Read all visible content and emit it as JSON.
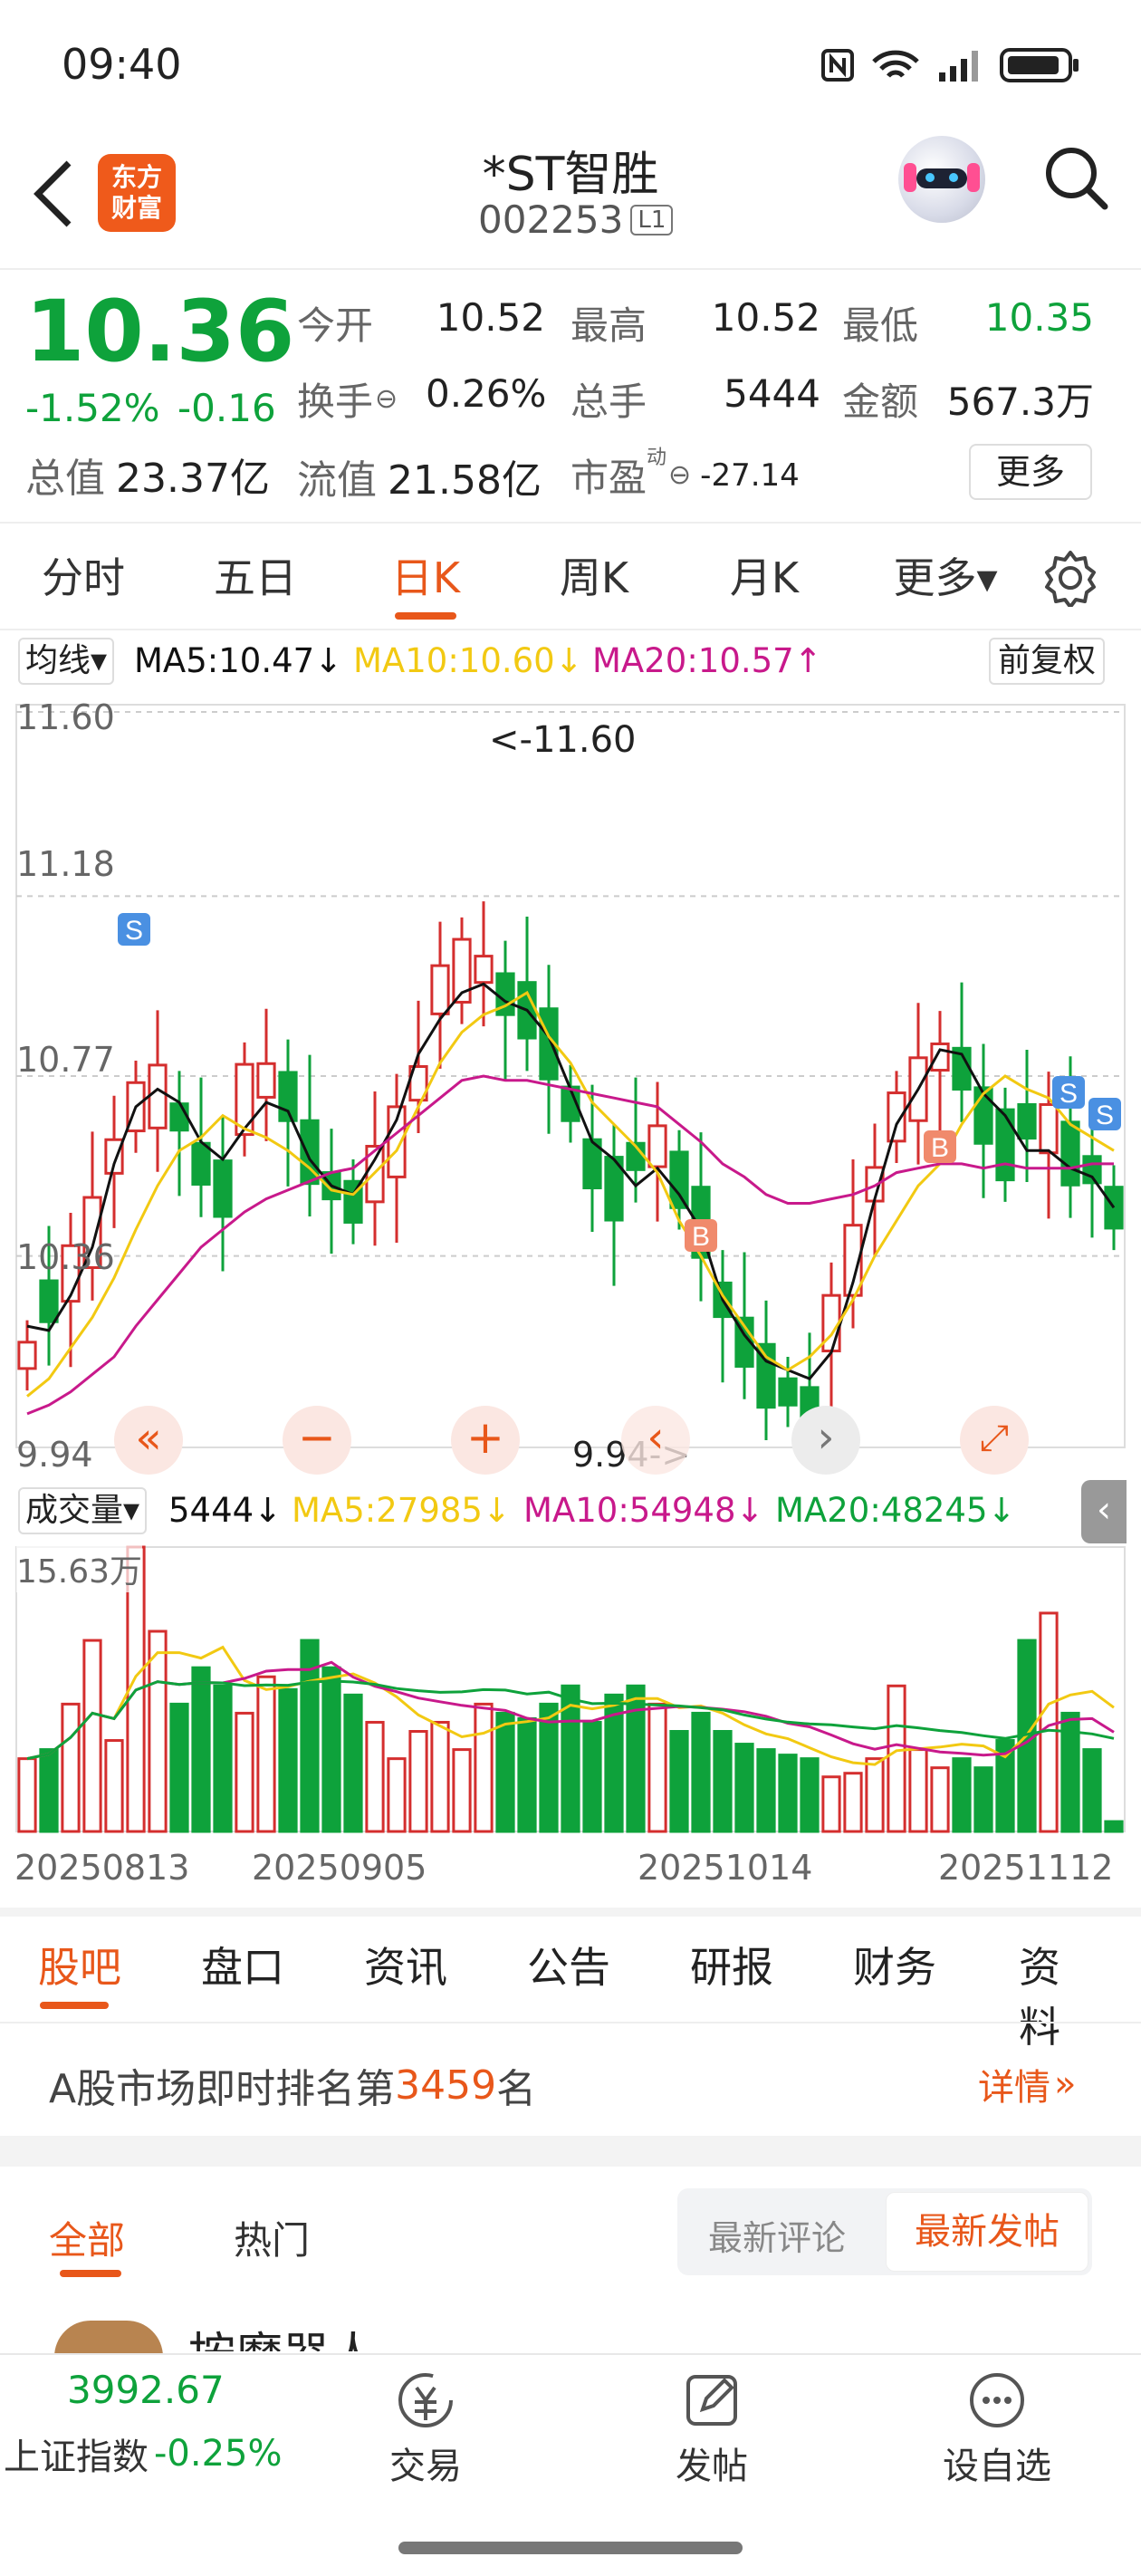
{
  "status": {
    "time": "09:40"
  },
  "header": {
    "logo_line1": "东方",
    "logo_line2": "财富",
    "stock_name": "*ST智胜",
    "stock_code": "002253",
    "level_badge": "L1"
  },
  "quote": {
    "price": "10.36",
    "change_pct": "-1.52%",
    "change": "-0.16",
    "open_label": "今开",
    "open": "10.52",
    "high_label": "最高",
    "high": "10.52",
    "low_label": "最低",
    "low": "10.35",
    "turnover_label": "换手",
    "turnover": "0.26%",
    "volume_label": "总手",
    "volume": "5444",
    "amount_label": "金额",
    "amount": "567.3万",
    "mcap_label": "总值",
    "mcap": "23.37亿",
    "float_label": "流值",
    "float_cap": "21.58亿",
    "pe_label": "市盈",
    "pe_sup": "动",
    "pe": "-27.14",
    "more_btn": "更多"
  },
  "chart_tabs": [
    {
      "label": "分时"
    },
    {
      "label": "五日"
    },
    {
      "label": "日K"
    },
    {
      "label": "周K"
    },
    {
      "label": "月K"
    },
    {
      "label": "更多▾"
    }
  ],
  "ma_bar": {
    "dropdown": "均线▾",
    "ma5": "MA5:10.47↓",
    "ma10": "MA10:10.60↓",
    "ma20": "MA20:10.57↑",
    "adjust": "前复权"
  },
  "kline": {
    "y_labels": [
      "11.60",
      "11.18",
      "10.77",
      "10.36",
      "9.94"
    ],
    "max_marker": "<-11.60",
    "min_marker": "9.94->",
    "signal_b": "B",
    "signal_s": "S"
  },
  "vol_bar": {
    "dropdown": "成交量▾",
    "vol": "5444↓",
    "ma5": "MA5:27985↓",
    "ma10": "MA10:54948↓",
    "ma20": "MA20:48245↓",
    "max_label": "15.63万"
  },
  "dates": [
    "20250813",
    "20250905",
    "20251014",
    "20251112"
  ],
  "section_tabs": [
    {
      "label": "股吧"
    },
    {
      "label": "盘口"
    },
    {
      "label": "资讯"
    },
    {
      "label": "公告"
    },
    {
      "label": "研报"
    },
    {
      "label": "财务"
    },
    {
      "label": "资料"
    }
  ],
  "rank": {
    "prefix": "A股市场即时排名第",
    "number": "3459",
    "suffix": "名",
    "detail": "详情"
  },
  "filter": {
    "all": "全部",
    "hot": "热门",
    "latest_comment": "最新评论",
    "latest_post": "最新发帖"
  },
  "post_preview": {
    "author": "按摩器人"
  },
  "bottom": {
    "index_value": "3992.67",
    "index_name": "上证指数",
    "index_change": "-0.25%",
    "trade": "交易",
    "post": "发帖",
    "watch": "设自选"
  },
  "colors": {
    "up": "#d42e2e",
    "down": "#0ea23b",
    "accent": "#e8571a",
    "ma5": "#111111",
    "ma10": "#f2c912",
    "ma20": "#c8198b"
  },
  "chart_data": {
    "type": "candlestick",
    "ylim": [
      9.94,
      11.6
    ],
    "series": [
      {
        "name": "MA5",
        "values": [
          10.2,
          10.19,
          10.27,
          10.38,
          10.57,
          10.7,
          10.74,
          10.71,
          10.62,
          10.58,
          10.65,
          10.71,
          10.69,
          10.58,
          10.52,
          10.5,
          10.58,
          10.67,
          10.82,
          10.9,
          10.96,
          10.98,
          10.94,
          10.92,
          10.86,
          10.74,
          10.62,
          10.58,
          10.52,
          10.56,
          10.5,
          10.42,
          10.26,
          10.18,
          10.12,
          10.1,
          10.08,
          10.14,
          10.3,
          10.49,
          10.66,
          10.74,
          10.83,
          10.82,
          10.73,
          10.68,
          10.6,
          10.6,
          10.56,
          10.54,
          10.47
        ]
      },
      {
        "name": "MA10",
        "values": [
          10.04,
          10.08,
          10.15,
          10.22,
          10.31,
          10.42,
          10.52,
          10.6,
          10.63,
          10.68,
          10.65,
          10.63,
          10.6,
          10.56,
          10.51,
          10.5,
          10.55,
          10.6,
          10.7,
          10.8,
          10.87,
          10.91,
          10.93,
          10.96,
          10.86,
          10.8,
          10.71,
          10.66,
          10.61,
          10.55,
          10.44,
          10.36,
          10.27,
          10.2,
          10.13,
          10.1,
          10.13,
          10.18,
          10.26,
          10.36,
          10.44,
          10.52,
          10.57,
          10.66,
          10.73,
          10.77,
          10.74,
          10.72,
          10.66,
          10.63,
          10.6
        ]
      },
      {
        "name": "MA20",
        "values": [
          10.0,
          10.02,
          10.05,
          10.09,
          10.13,
          10.2,
          10.26,
          10.32,
          10.38,
          10.42,
          10.46,
          10.49,
          10.51,
          10.53,
          10.55,
          10.56,
          10.6,
          10.64,
          10.68,
          10.72,
          10.76,
          10.77,
          10.76,
          10.76,
          10.75,
          10.74,
          10.73,
          10.72,
          10.71,
          10.7,
          10.66,
          10.62,
          10.57,
          10.54,
          10.5,
          10.48,
          10.48,
          10.49,
          10.5,
          10.52,
          10.55,
          10.56,
          10.57,
          10.57,
          10.56,
          10.57,
          10.56,
          10.56,
          10.56,
          10.57,
          10.57
        ]
      },
      {
        "name": "成交量",
        "values": [
          40000,
          45000,
          70000,
          105000,
          50000,
          156300,
          110000,
          70000,
          90000,
          80000,
          65000,
          85000,
          78000,
          105000,
          90000,
          75000,
          60000,
          40000,
          55000,
          60000,
          45000,
          70000,
          65000,
          62000,
          70000,
          80000,
          60000,
          75000,
          80000,
          70000,
          55000,
          65000,
          55000,
          48000,
          45000,
          42000,
          40000,
          30000,
          32000,
          40000,
          80000,
          45000,
          35000,
          40000,
          35000,
          50000,
          105000,
          120000,
          65000,
          45000,
          5444
        ]
      }
    ]
  }
}
